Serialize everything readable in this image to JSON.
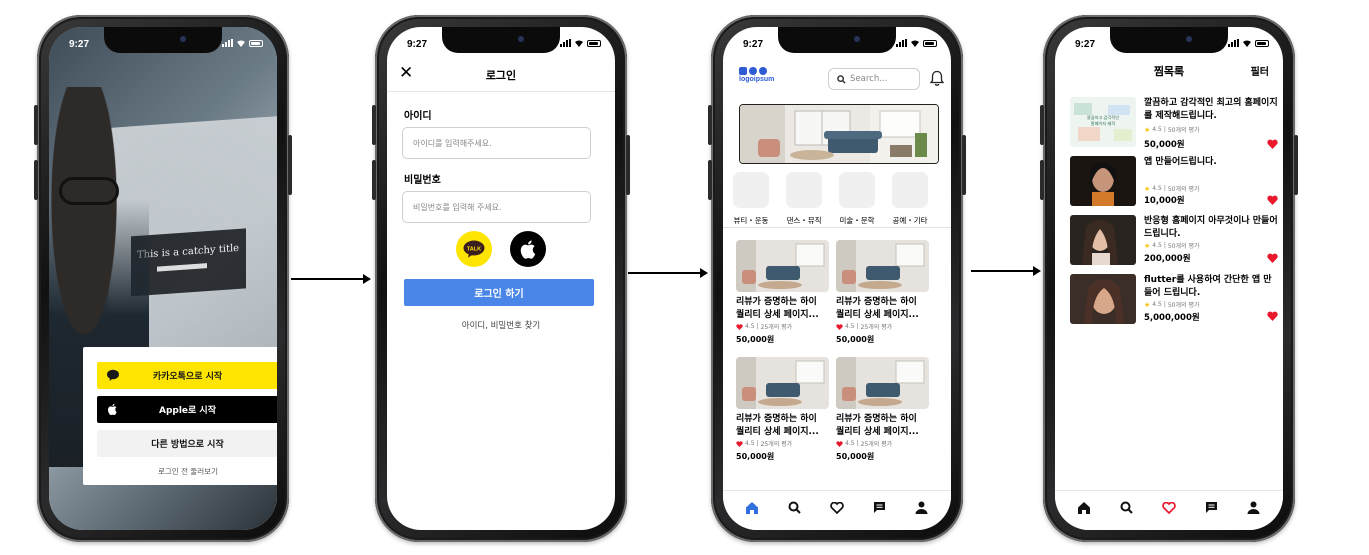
{
  "status_time": "9:27",
  "screen1": {
    "monitor_headline": "This is a catchy title",
    "kakao_label": "카카오톡으로 시작",
    "apple_label": "Apple로 시작",
    "other_label": "다른 방법으로 시작",
    "browse_label": "로그인 전 둘러보기"
  },
  "screen2": {
    "title": "로그인",
    "id_label": "아이디",
    "id_placeholder": "아이디를 입력해주세요.",
    "pw_label": "비밀번호",
    "pw_placeholder": "비밀번호를 입력해 주세요.",
    "kakao_icon_text": "TALK",
    "login_button": "로그인 하기",
    "find_link": "아이디, 비밀번호 찾기"
  },
  "screen3": {
    "logo_text": "logoipsum",
    "search_placeholder": "Search...",
    "categories": [
      "뷰티・운동",
      "댄스・뮤직",
      "미술・문학",
      "공예・기타"
    ],
    "cards": [
      {
        "title1": "리뷰가 증명하는 하이",
        "title2": "퀄리티 상세 페이지...",
        "rating": "4.5",
        "reviews": "25개의 평가",
        "price": "50,000원"
      },
      {
        "title1": "리뷰가 증명하는 하이",
        "title2": "퀄리티 상세 페이지...",
        "rating": "4.5",
        "reviews": "25개의 평가",
        "price": "50,000원"
      },
      {
        "title1": "리뷰가 증명하는 하이",
        "title2": "퀄리티 상세 페이지...",
        "rating": "4.5",
        "reviews": "25개의 평가",
        "price": "50,000원"
      },
      {
        "title1": "리뷰가 증명하는 하이",
        "title2": "퀄리티 상세 페이지...",
        "rating": "4.5",
        "reviews": "25개의 평가",
        "price": "50,000원"
      }
    ],
    "tabs": [
      "home-icon",
      "search-icon",
      "heart-icon",
      "chat-icon",
      "profile-icon"
    ]
  },
  "screen4": {
    "title": "찜목록",
    "filter": "필터",
    "items": [
      {
        "title": "깔끔하고 감각적인 최고의 홈페이지를 제작해드립니다.",
        "rating": "4.5",
        "reviews": "50개의 평가",
        "price": "50,000원"
      },
      {
        "title": "앱 만들어드립니다.",
        "rating": "4.5",
        "reviews": "50개의 평가",
        "price": "10,000원"
      },
      {
        "title": "반응형 홈페이지 아무것이나 만들어드립니다.",
        "rating": "4.5",
        "reviews": "50개의 평가",
        "price": "200,000원"
      },
      {
        "title": "flutter를 사용하여 간단한 앱 만들어 드립니다.",
        "rating": "4.5",
        "reviews": "50개의 평가",
        "price": "5,000,000원"
      }
    ],
    "thumb1_lines": [
      "깔끔하고 감각적인",
      "홈페이지 제작"
    ]
  },
  "colors": {
    "kakao_yellow": "#fee500",
    "primary_blue": "#4a86e8",
    "logo_blue": "#2f5bd3",
    "heart_red": "#e8192c",
    "star_yellow": "#f5c518",
    "active_tab_blue": "#2f6fe0"
  }
}
